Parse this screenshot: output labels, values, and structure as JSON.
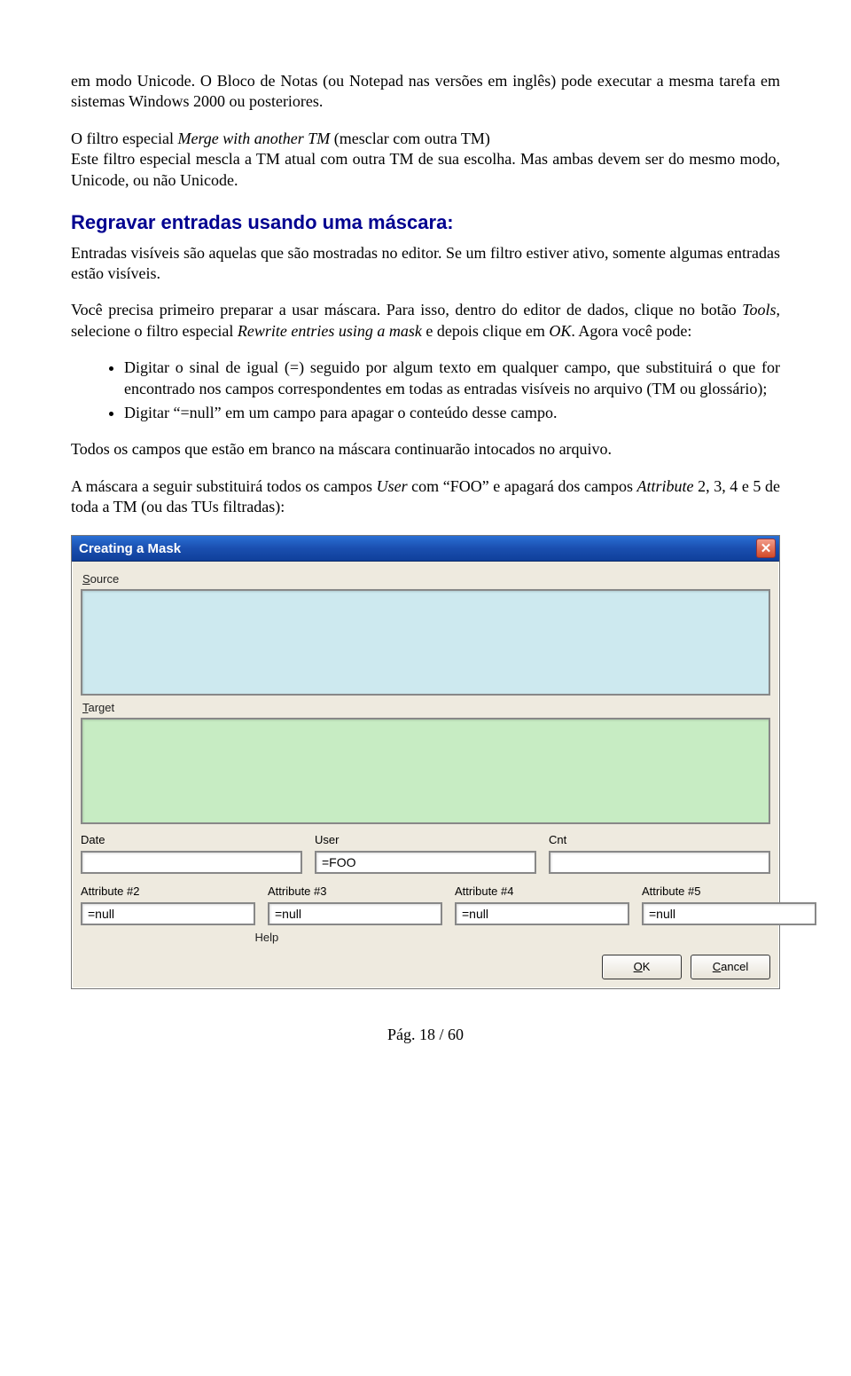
{
  "text": {
    "p1": "em modo Unicode. O Bloco de Notas (ou Notepad nas versões em inglês) pode executar a mesma tarefa em sistemas Windows 2000 ou posteriores.",
    "p2a": "O filtro especial ",
    "p2_merge": "Merge with another TM",
    "p2b": " (mesclar com outra TM)",
    "p2c": "Este filtro especial mescla a TM atual com outra TM de sua escolha. Mas ambas devem ser do mesmo modo, Unicode, ou não Unicode.",
    "h3": "Regravar entradas usando uma máscara:",
    "p3": " Entradas visíveis são aquelas que são mostradas no editor. Se um filtro estiver ativo, somente algumas entradas estão visíveis.",
    "p4a": "Você precisa primeiro preparar a usar máscara. Para isso, dentro do editor de dados, clique no botão ",
    "p4_tools": "Tools",
    "p4b": ", selecione o filtro especial ",
    "p4_rew": "Rewrite entries using a mask",
    "p4c": " e depois clique em ",
    "p4_ok": "OK",
    "p4d": ". Agora você pode:",
    "li1": "Digitar o sinal de igual (=) seguido por algum texto em qualquer campo, que substituirá o que for encontrado nos campos correspondentes em todas as entradas visíveis no arquivo (TM ou glossário);",
    "li2": "Digitar “=null” em um campo para apagar o conteúdo desse campo.",
    "p5": "Todos os campos que estão em branco na máscara continuarão intocados no arquivo.",
    "p6a": "A máscara a seguir substituirá todos os campos ",
    "p6_user": "User",
    "p6b": " com “FOO” e apagará dos campos ",
    "p6_attr": "Attribute",
    "p6c": " 2, 3, 4 e 5 de toda a TM (ou das TUs filtradas):"
  },
  "dialog": {
    "title": "Creating a Mask",
    "close_sym": "✕",
    "source_label_letter": "S",
    "source_label_rest": "ource",
    "target_label_letter": "T",
    "target_label_rest": "arget",
    "fields": {
      "date": {
        "label": "Date",
        "value": ""
      },
      "user": {
        "label": "User",
        "value": "=FOO"
      },
      "cnt": {
        "label": "Cnt",
        "value": ""
      }
    },
    "attrs": {
      "a2": {
        "label": "Attribute #2",
        "value": "=null"
      },
      "a3": {
        "label": "Attribute #3",
        "value": "=null"
      },
      "a4": {
        "label": "Attribute #4",
        "value": "=null"
      },
      "a5": {
        "label": "Attribute #5",
        "value": "=null"
      }
    },
    "help": "Help",
    "ok_letter": "O",
    "ok_rest": "K",
    "cancel_letter": "C",
    "cancel_rest": "ancel"
  },
  "footer": "Pág. 18 / 60"
}
